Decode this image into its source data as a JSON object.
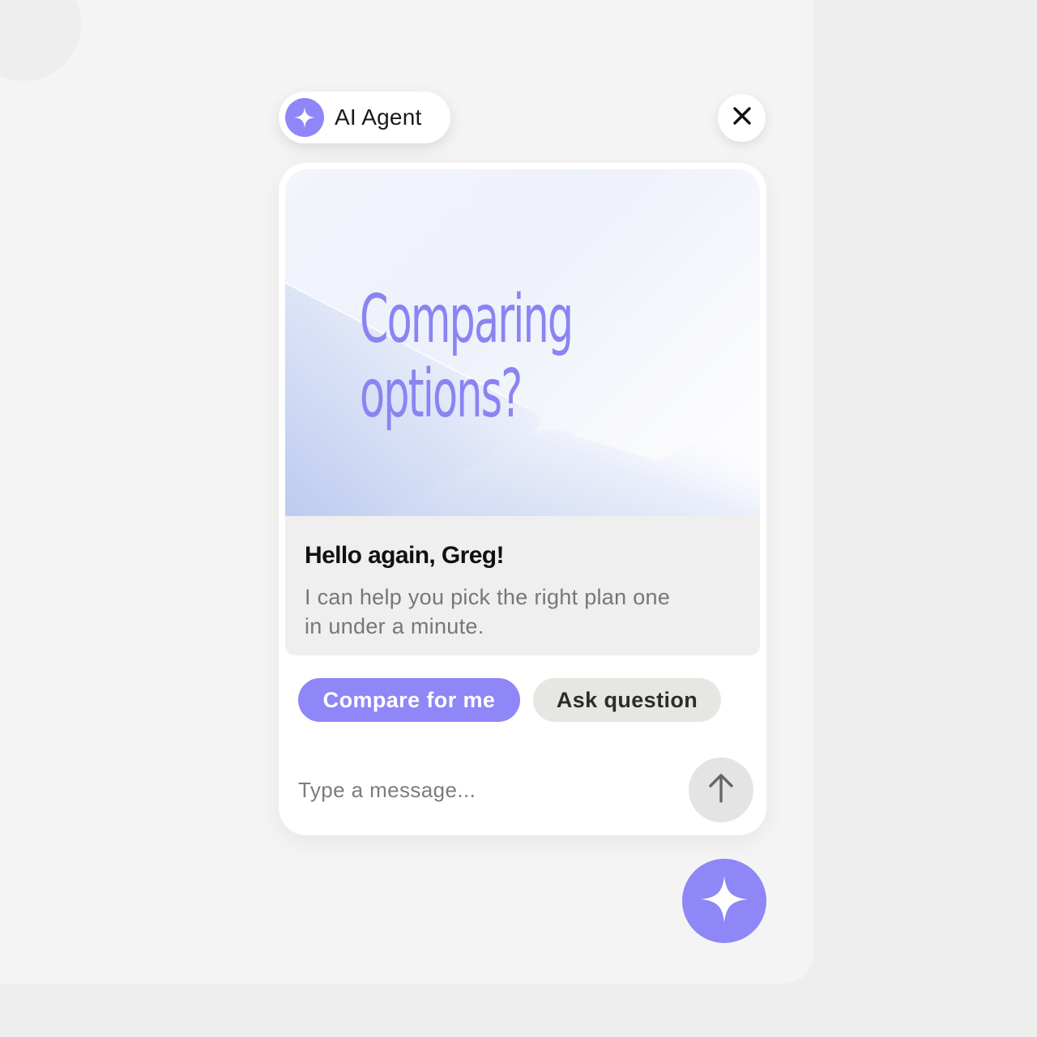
{
  "agent": {
    "label": "AI Agent",
    "icon": "sparkle-icon"
  },
  "header": {
    "close_icon": "close-icon"
  },
  "card": {
    "hero_title": "Comparing\noptions?",
    "greeting": "Hello again, Greg!",
    "subtext": "I can help you pick the right plan one in under a minute."
  },
  "actions": {
    "primary_label": "Compare for me",
    "secondary_label": "Ask question"
  },
  "composer": {
    "placeholder": "Type a message...",
    "send_icon": "arrow-up-icon"
  },
  "launcher": {
    "icon": "sparkle-icon"
  },
  "colors": {
    "accent": "#8f86f7",
    "hero_text": "#8a84f3",
    "chip_secondary_bg": "#e6e7e3"
  }
}
